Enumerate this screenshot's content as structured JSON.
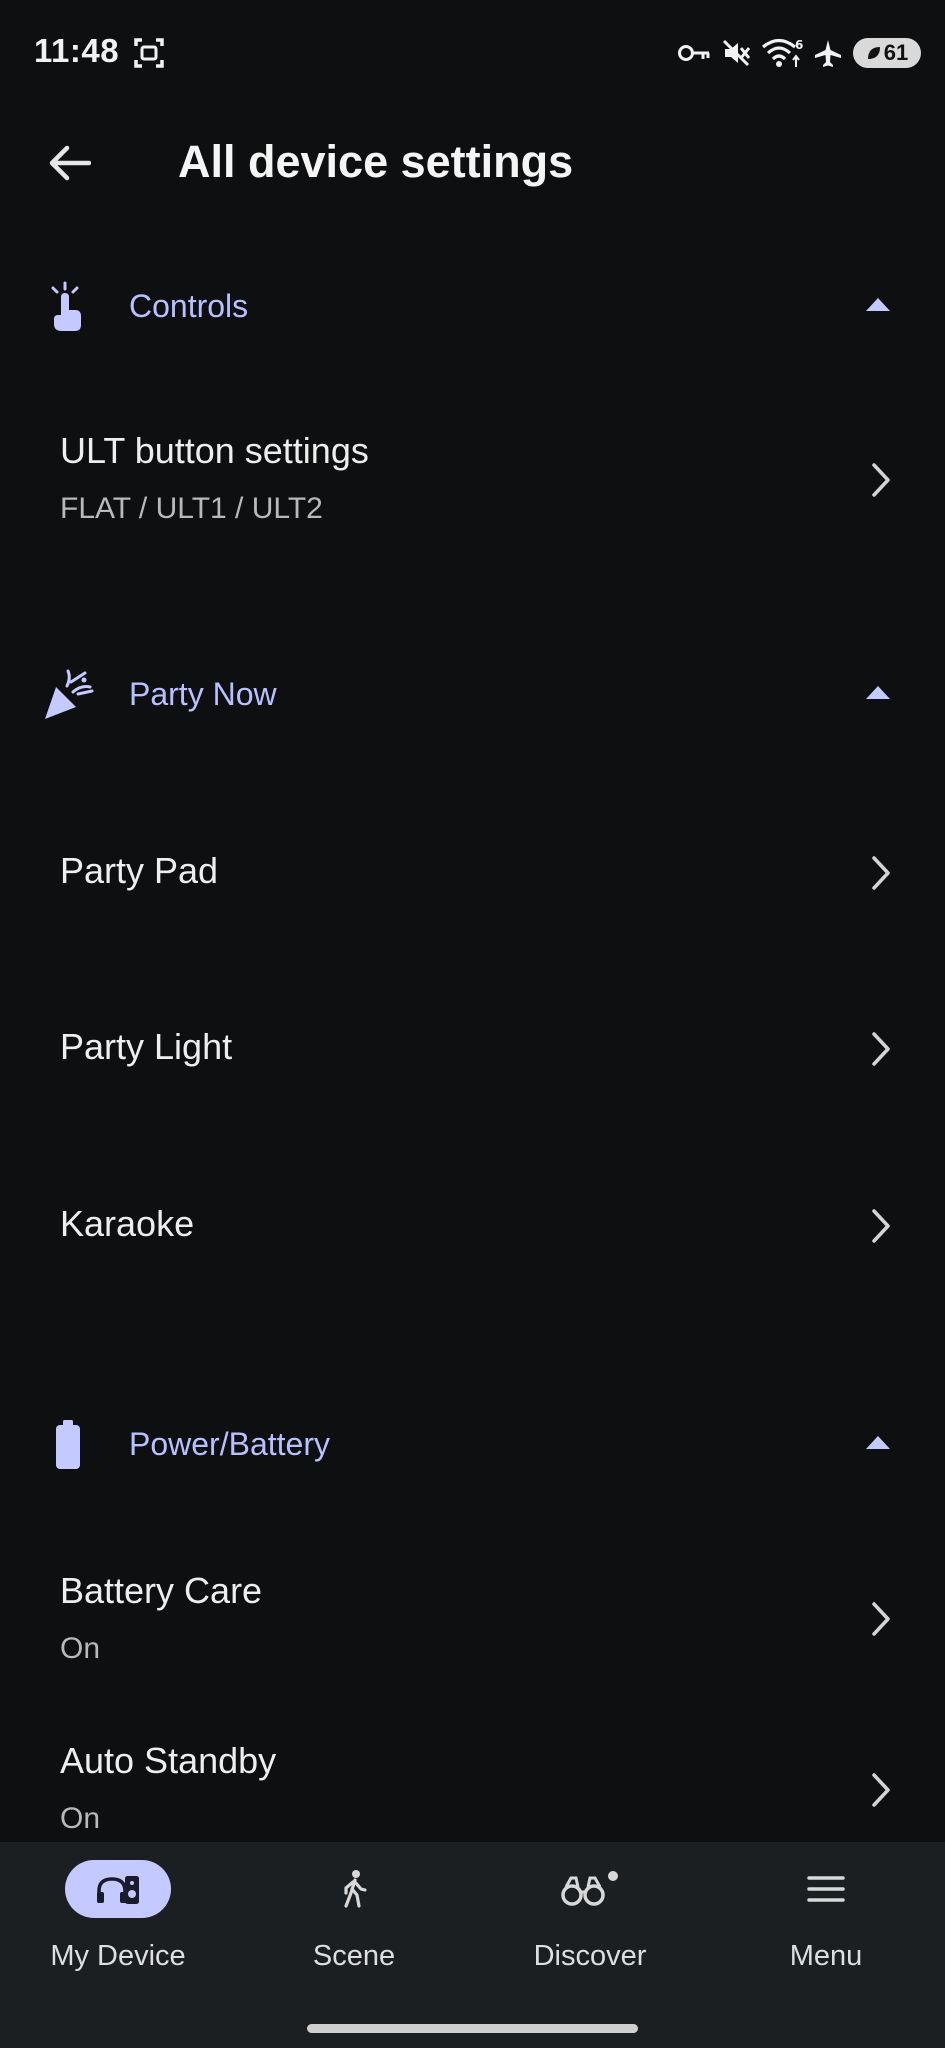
{
  "status": {
    "time": "11:48",
    "battery": "61"
  },
  "header": {
    "title": "All device settings"
  },
  "sections": {
    "controls": {
      "label": "Controls",
      "items": [
        {
          "title": "ULT button settings",
          "subtitle": "FLAT / ULT1 / ULT2"
        }
      ]
    },
    "party_now": {
      "label": "Party Now",
      "items": [
        {
          "title": "Party Pad"
        },
        {
          "title": "Party Light"
        },
        {
          "title": "Karaoke"
        }
      ]
    },
    "power_battery": {
      "label": "Power/Battery",
      "items": [
        {
          "title": "Battery Care",
          "subtitle": "On"
        },
        {
          "title": "Auto Standby",
          "subtitle": "On"
        }
      ]
    }
  },
  "nav": {
    "items": [
      {
        "label": "My Device",
        "icon": "device-icon"
      },
      {
        "label": "Scene",
        "icon": "walking-person-icon"
      },
      {
        "label": "Discover",
        "icon": "binoculars-icon"
      },
      {
        "label": "Menu",
        "icon": "hamburger-menu-icon"
      }
    ]
  },
  "colors": {
    "accent": "#b8c0ff",
    "nav_active": "#c4c9ff",
    "background": "#0d0f10"
  }
}
